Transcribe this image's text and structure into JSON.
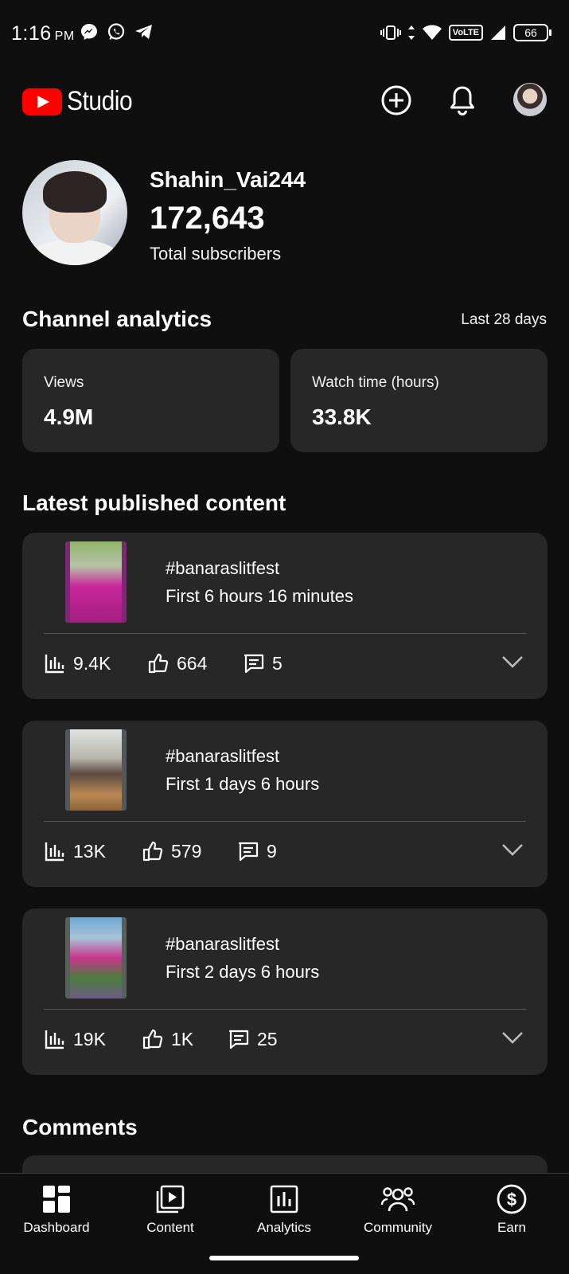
{
  "status_bar": {
    "time": "1:16",
    "ampm": "PM",
    "volte": "VoLTE",
    "battery": "66"
  },
  "header": {
    "logo_text": "Studio",
    "icons": [
      "create-icon",
      "notifications-icon",
      "account-avatar"
    ]
  },
  "channel": {
    "name": "Shahin_Vai244",
    "subscribers": "172,643",
    "subscribers_label": "Total subscribers"
  },
  "analytics": {
    "title": "Channel analytics",
    "range": "Last 28 days",
    "cards": [
      {
        "label": "Views",
        "value": "4.9M"
      },
      {
        "label": "Watch time (hours)",
        "value": "33.8K"
      }
    ]
  },
  "latest": {
    "title": "Latest published content",
    "items": [
      {
        "title": "#banaraslitfest",
        "subtitle": "First 6 hours 16 minutes",
        "views": "9.4K",
        "likes": "664",
        "comments": "5"
      },
      {
        "title": "#banaraslitfest",
        "subtitle": "First 1 days 6 hours",
        "views": "13K",
        "likes": "579",
        "comments": "9"
      },
      {
        "title": "#banaraslitfest",
        "subtitle": "First 2 days 6 hours",
        "views": "19K",
        "likes": "1K",
        "comments": "25"
      }
    ]
  },
  "comments": {
    "title": "Comments"
  },
  "bottom_nav": {
    "items": [
      {
        "label": "Dashboard",
        "icon": "dashboard-icon"
      },
      {
        "label": "Content",
        "icon": "content-icon"
      },
      {
        "label": "Analytics",
        "icon": "analytics-icon"
      },
      {
        "label": "Community",
        "icon": "community-icon"
      },
      {
        "label": "Earn",
        "icon": "earn-icon"
      }
    ]
  },
  "colors": {
    "background": "#0f0f0f",
    "card": "#272727",
    "brand_red": "#ff0000",
    "text": "#ffffff"
  }
}
